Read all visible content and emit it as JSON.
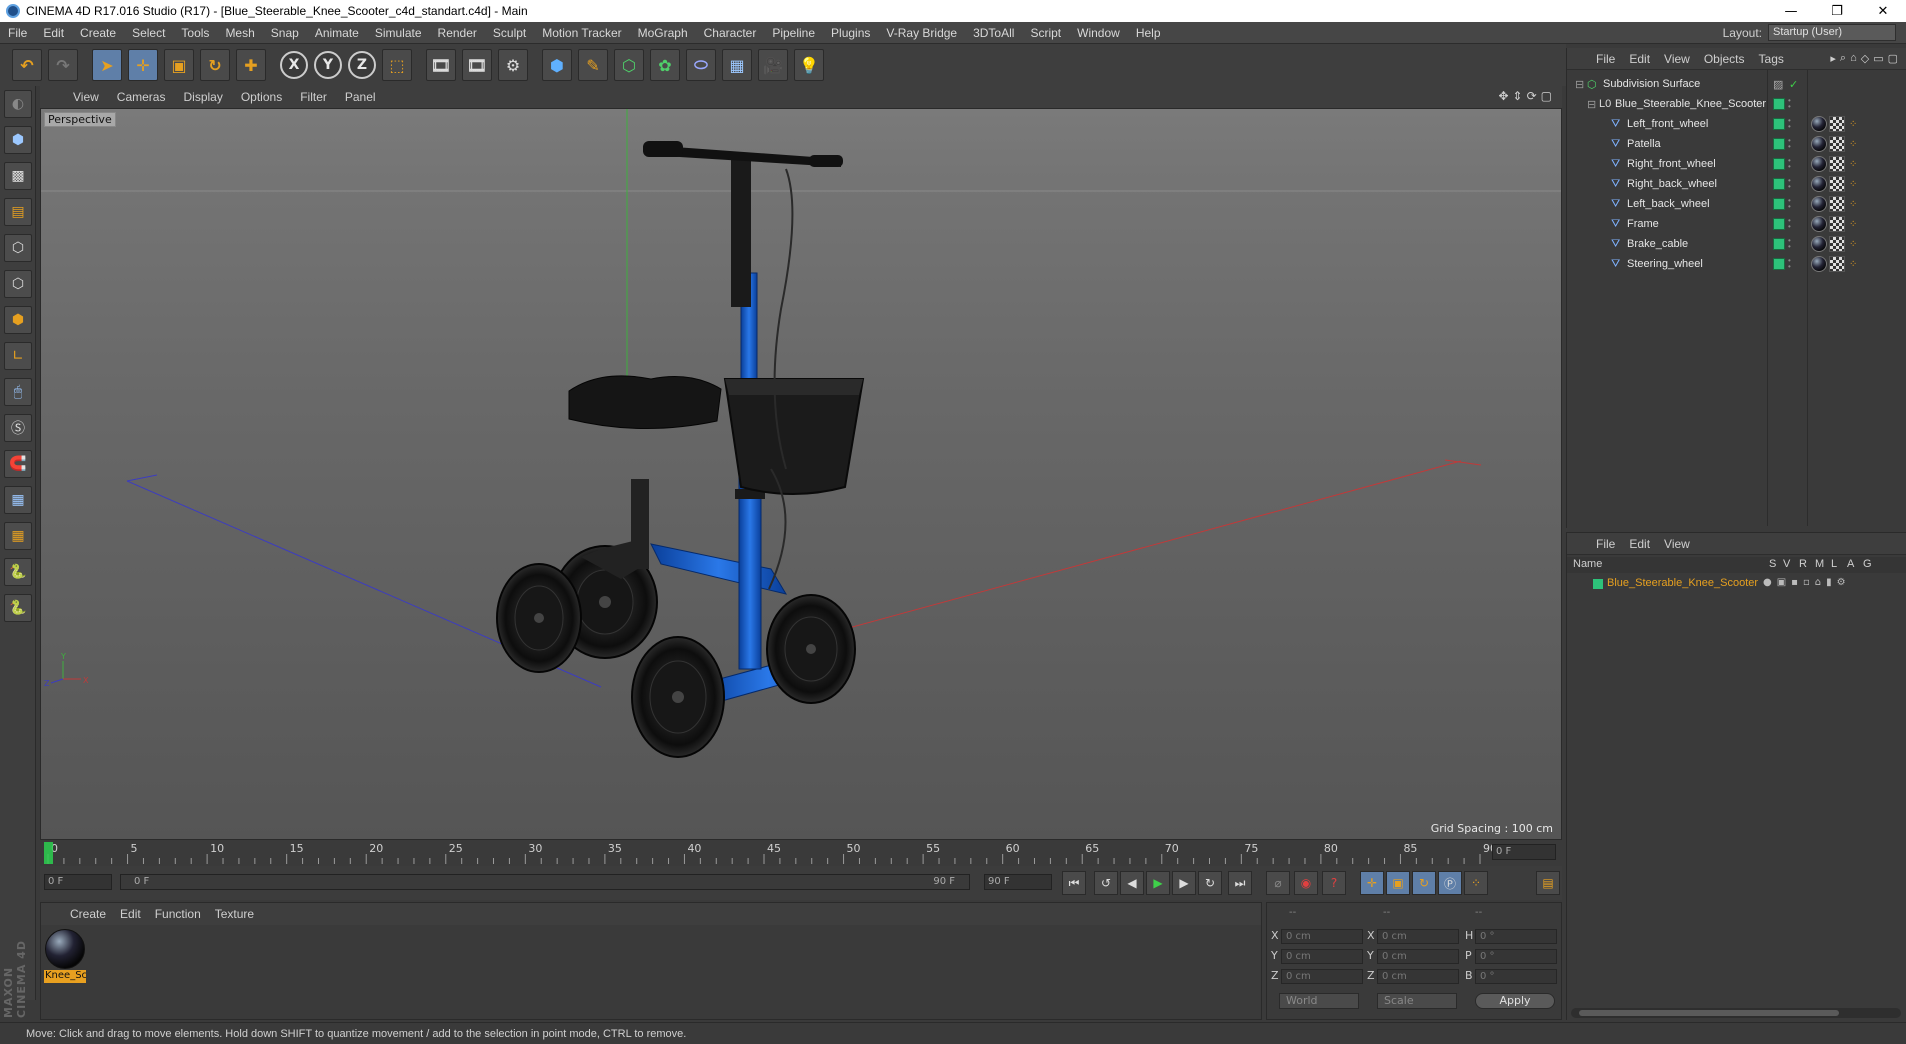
{
  "window": {
    "title": "CINEMA 4D R17.016 Studio (R17) - [Blue_Steerable_Knee_Scooter_c4d_standart.c4d] - Main",
    "minimize": "—",
    "restore": "❐",
    "close": "✕"
  },
  "menu": {
    "items": [
      "File",
      "Edit",
      "Create",
      "Select",
      "Tools",
      "Mesh",
      "Snap",
      "Animate",
      "Simulate",
      "Render",
      "Sculpt",
      "Motion Tracker",
      "MoGraph",
      "Character",
      "Pipeline",
      "Plugins",
      "V-Ray Bridge",
      "3DToAll",
      "Script",
      "Window",
      "Help"
    ],
    "layout_label": "Layout:",
    "layout_value": "Startup (User)"
  },
  "toolbar": {
    "axis_x": "X",
    "axis_y": "Y",
    "axis_z": "Z"
  },
  "viewport": {
    "menu": [
      "View",
      "Cameras",
      "Display",
      "Options",
      "Filter",
      "Panel"
    ],
    "camera_label": "Perspective",
    "grid_spacing": "Grid Spacing : 100 cm",
    "axis_x": "X",
    "axis_y": "Y",
    "axis_z": "Z"
  },
  "timeline": {
    "ticks": [
      "0",
      "5",
      "10",
      "15",
      "20",
      "25",
      "30",
      "35",
      "40",
      "45",
      "50",
      "55",
      "60",
      "65",
      "70",
      "75",
      "80",
      "85",
      "90"
    ],
    "current_frame": "0 F"
  },
  "transport": {
    "start_field": "0 F",
    "range_start": "0 F",
    "range_end": "90 F",
    "end_field": "90 F"
  },
  "material_panel": {
    "menu": [
      "Create",
      "Edit",
      "Function",
      "Texture"
    ],
    "material_name": "Knee_Sc"
  },
  "coords": {
    "headers": [
      "--",
      "--",
      "--"
    ],
    "rows": [
      {
        "l1": "X",
        "v1": "0 cm",
        "l2": "X",
        "v2": "0 cm",
        "l3": "H",
        "v3": "0 °"
      },
      {
        "l1": "Y",
        "v1": "0 cm",
        "l2": "Y",
        "v2": "0 cm",
        "l3": "P",
        "v3": "0 °"
      },
      {
        "l1": "Z",
        "v1": "0 cm",
        "l2": "Z",
        "v2": "0 cm",
        "l3": "B",
        "v3": "0 °"
      }
    ],
    "world": "World",
    "scale": "Scale",
    "apply": "Apply"
  },
  "object_manager": {
    "menu": [
      "File",
      "Edit",
      "View",
      "Objects",
      "Tags"
    ],
    "objects": [
      {
        "name": "Subdivision Surface",
        "indent": 0
      },
      {
        "name": "Blue_Steerable_Knee_Scooter",
        "indent": 1
      },
      {
        "name": "Left_front_wheel",
        "indent": 2
      },
      {
        "name": "Patella",
        "indent": 2
      },
      {
        "name": "Right_front_wheel",
        "indent": 2
      },
      {
        "name": "Right_back_wheel",
        "indent": 2
      },
      {
        "name": "Left_back_wheel",
        "indent": 2
      },
      {
        "name": "Frame",
        "indent": 2
      },
      {
        "name": "Brake_cable",
        "indent": 2
      },
      {
        "name": "Steering_wheel",
        "indent": 2
      }
    ]
  },
  "layer_manager": {
    "menu": [
      "File",
      "Edit",
      "View"
    ],
    "headers": [
      "Name",
      "S",
      "V",
      "R",
      "M",
      "L",
      "A",
      "G"
    ],
    "layer_name": "Blue_Steerable_Knee_Scooter"
  },
  "maxon": "MAXON CINEMA 4D",
  "status": "Move: Click and drag to move elements. Hold down SHIFT to quantize movement / add to the selection in point mode, CTRL to remove."
}
